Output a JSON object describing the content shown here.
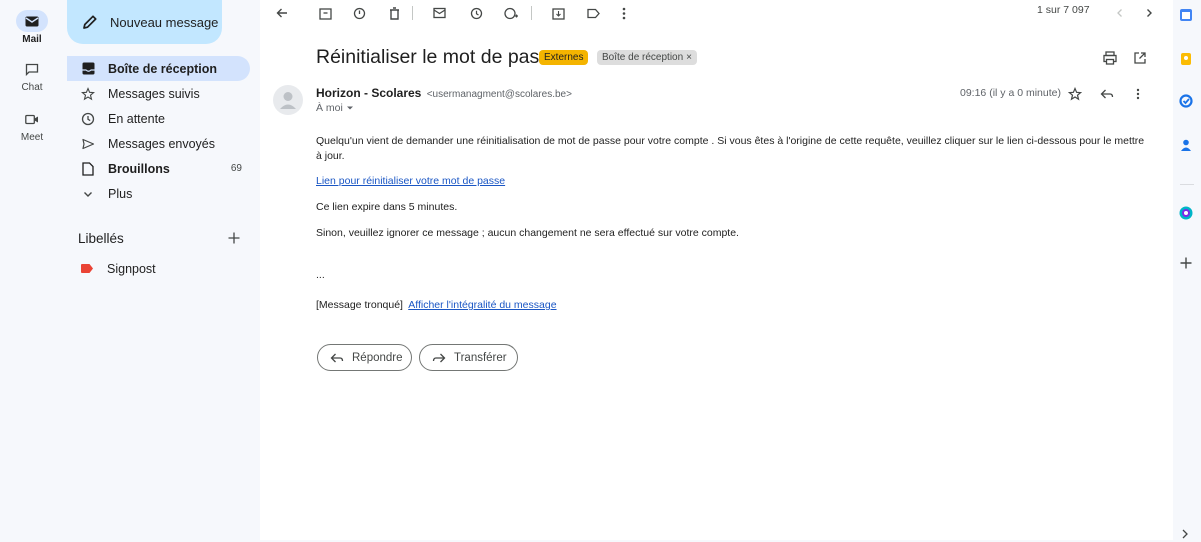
{
  "rail": {
    "mail_label": "Mail",
    "chat_label": "Chat",
    "meet_label": "Meet"
  },
  "compose": {
    "label": "Nouveau message"
  },
  "nav": {
    "items": [
      {
        "label": "Boîte de réception",
        "icon": "inbox-icon"
      },
      {
        "label": "Messages suivis",
        "icon": "star-icon"
      },
      {
        "label": "En attente",
        "icon": "clock-icon"
      },
      {
        "label": "Messages envoyés",
        "icon": "send-icon"
      },
      {
        "label": "Brouillons",
        "icon": "draft-icon",
        "count": "69"
      },
      {
        "label": "Plus",
        "icon": "chevron-down-icon"
      }
    ]
  },
  "labels": {
    "heading": "Libellés",
    "items": [
      {
        "label": "Signpost",
        "color": "#ea4335"
      }
    ]
  },
  "toolbar": {
    "pager": "1 sur 7 097"
  },
  "message": {
    "subject": "Réinitialiser le mot de passe",
    "chip_externes": "Externes",
    "chip_inbox": "Boîte de réception",
    "chip_close": "×",
    "sender_name": "Horizon - Scolares",
    "sender_email": "<usermanagment@scolares.be>",
    "recipient": "À moi",
    "time": "09:16 (il y a 0 minute)",
    "body_p1": "Quelqu'un vient de demander une réinitialisation de mot de passe pour votre compte . Si vous êtes à l'origine de cette requête, veuillez cliquer sur le lien ci-dessous pour le mettre à jour.",
    "reset_link": "Lien pour réinitialiser votre mot de passe",
    "body_p2": "Ce lien expire dans 5 minutes.",
    "body_p3": "Sinon, veuillez ignorer ce message ; aucun changement ne sera effectué sur votre compte.",
    "ellipsis": "...",
    "truncated": "[Message tronqué]",
    "show_full": "Afficher l'intégralité du message"
  },
  "actions": {
    "reply": "Répondre",
    "forward": "Transférer"
  },
  "colors": {
    "accent": "#c2e7ff",
    "active_nav": "#d3e3fd",
    "externes_chip": "#f4b400",
    "link": "#1a56c4"
  }
}
